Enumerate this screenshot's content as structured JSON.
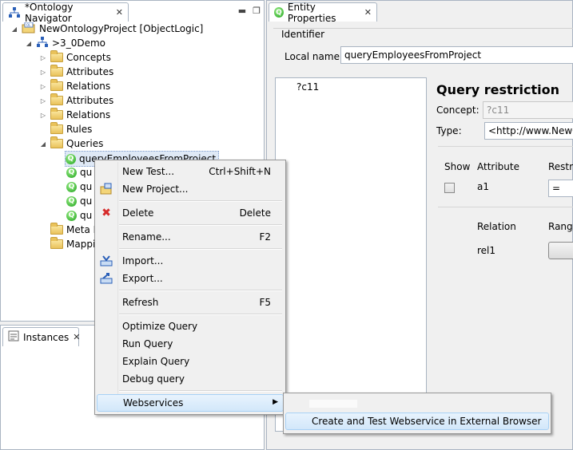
{
  "navigator": {
    "title": "*Ontology Navigator",
    "project": "NewOntologyProject [ObjectLogic]",
    "module": ">3_0Demo",
    "folders": [
      "Concepts",
      "Attributes",
      "Relations",
      "Attributes",
      "Relations",
      "Rules",
      "Queries"
    ],
    "queries": [
      "queryEmployeesFromProject",
      "qu",
      "qu",
      "qu",
      "qu"
    ],
    "more_folders": [
      "Meta M",
      "Mappi"
    ]
  },
  "instances": {
    "title": "Instances"
  },
  "entity": {
    "tab_title": "Entity Properties",
    "identifier_label": "Identifier",
    "local_name_label": "Local name:",
    "local_name_value": "queryEmployeesFromProject",
    "var_text": "?c11",
    "restriction_title": "Query restriction",
    "concept_label": "Concept:",
    "concept_value": "?c11",
    "type_label": "Type:",
    "type_value": "<http://www.NewO",
    "col_show": "Show",
    "col_attribute": "Attribute",
    "col_restriction": "Restrictio",
    "attr_name": "a1",
    "attr_op": "=",
    "col_relation": "Relation",
    "col_range": "Range",
    "rel_name": "rel1"
  },
  "menu": {
    "items": [
      {
        "label": "New Test...",
        "accel": "Ctrl+Shift+N"
      },
      {
        "label": "New Project...",
        "accel": ""
      },
      {
        "label": "Delete",
        "accel": "Delete"
      },
      {
        "label": "Rename...",
        "accel": "F2"
      },
      {
        "label": "Import...",
        "accel": ""
      },
      {
        "label": "Export...",
        "accel": ""
      },
      {
        "label": "Refresh",
        "accel": "F5"
      },
      {
        "label": "Optimize Query",
        "accel": ""
      },
      {
        "label": "Run Query",
        "accel": ""
      },
      {
        "label": "Explain Query",
        "accel": ""
      },
      {
        "label": "Debug query",
        "accel": ""
      },
      {
        "label": "Webservices",
        "accel": ""
      }
    ],
    "submenu_item": "Create and Test Webservice in External Browser"
  }
}
